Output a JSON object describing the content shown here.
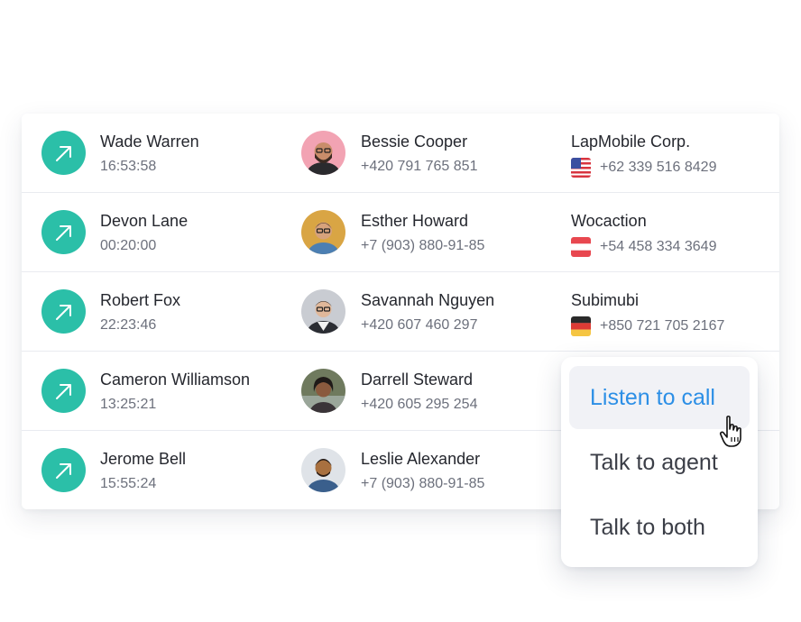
{
  "calls": [
    {
      "caller": "Wade Warren",
      "duration": "16:53:58",
      "contact_name": "Bessie Cooper",
      "contact_phone": "+420 791 765 851",
      "company": "LapMobile Corp.",
      "company_phone": "+62 339 516 8429",
      "flag": "us-flag-icon"
    },
    {
      "caller": "Devon Lane",
      "duration": "00:20:00",
      "contact_name": "Esther Howard",
      "contact_phone": "+7 (903) 880-91-85",
      "company": "Wocaction",
      "company_phone": "+54 458 334 3649",
      "flag": "austria-flag-icon"
    },
    {
      "caller": "Robert Fox",
      "duration": "22:23:46",
      "contact_name": "Savannah Nguyen",
      "contact_phone": "+420 607 460 297",
      "company": "Subimubi",
      "company_phone": "+850 721 705 2167",
      "flag": "germany-flag-icon"
    },
    {
      "caller": "Cameron Williamson",
      "duration": "13:25:21",
      "contact_name": "Darrell Steward",
      "contact_phone": "+420 605 295 254"
    },
    {
      "caller": "Jerome Bell",
      "duration": "15:55:24",
      "contact_name": "Leslie Alexander",
      "contact_phone": "+7 (903) 880-91-85"
    }
  ],
  "menu": {
    "items": [
      "Listen to call",
      "Talk to agent",
      "Talk to both"
    ],
    "active_index": 0
  },
  "colors": {
    "accent": "#2bbfa8",
    "link": "#2c8fe6"
  }
}
